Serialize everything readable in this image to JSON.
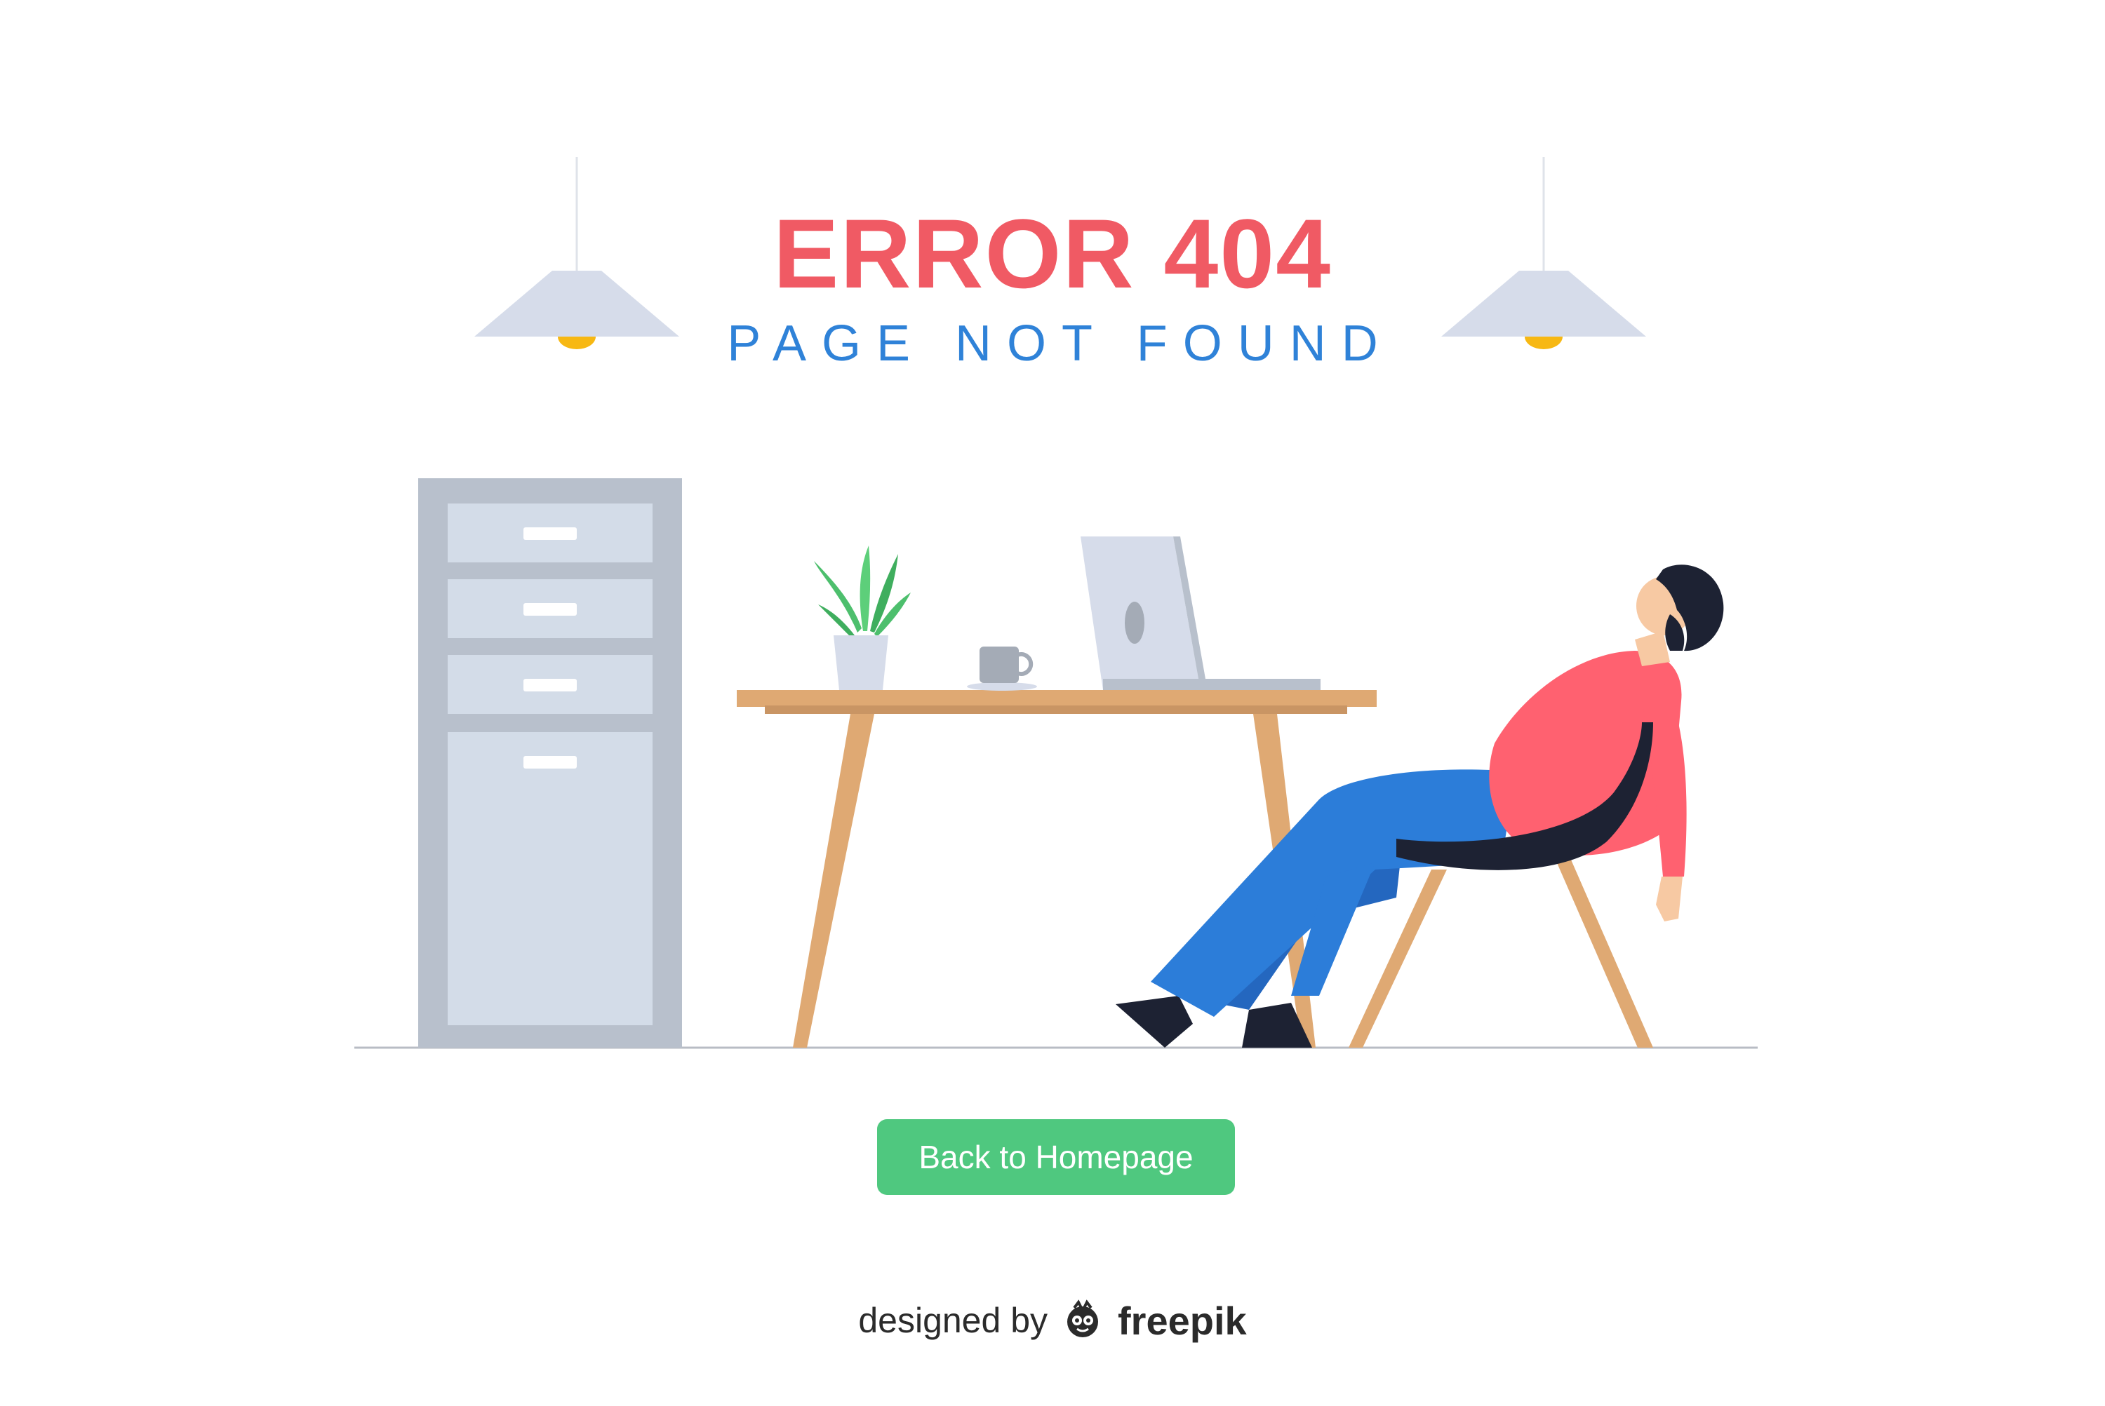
{
  "error": {
    "title": "ERROR 404",
    "subtitle": "PAGE NOT FOUND"
  },
  "actions": {
    "back_label": "Back to Homepage"
  },
  "credit": {
    "prefix": "designed by",
    "brand": "freepik"
  },
  "colors": {
    "title": "#f05a64",
    "subtitle": "#2f82d8",
    "button": "#4fc87f",
    "shirt": "#ff6170",
    "pants": "#2c7dd9",
    "desk": "#dfa973",
    "cabinet": "#b8c0cc",
    "drawer": "#d3dce8",
    "lamp": "#d6dcea",
    "bulb": "#f7b813"
  },
  "icons": {
    "credit_logo": "freepik-logo-icon"
  }
}
